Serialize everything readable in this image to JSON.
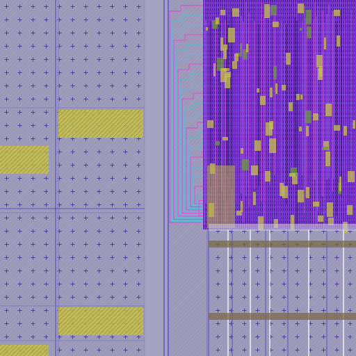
{
  "view": {
    "kind": "ic-layout-view",
    "colors": {
      "background": "#9b98b8",
      "grid_cross": "#4a3a9a",
      "metal_purple": "#7a2ad0",
      "metal_purple_dark": "#5b1fa6",
      "metal_cyan": "#3fc6d6",
      "metal_magenta": "#e34ad6",
      "yellow_block": "#c9c24a",
      "yellow_block_dark": "#8f8a2e",
      "rail_blue": "#4b45c8",
      "lane_light": "#b5b1c8",
      "brown_band": "#7a6a4a",
      "green_poly": "#6c9a3a"
    }
  }
}
